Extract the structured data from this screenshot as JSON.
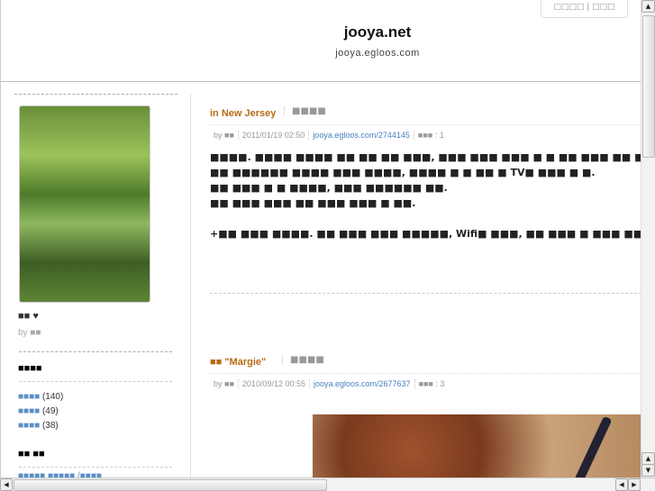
{
  "header": {
    "title": "jooya.net",
    "subtitle": "jooya.egloos.com",
    "top_menu": "□□□□ | □□□"
  },
  "sidebar": {
    "profile_name": "■■",
    "heart": "♥",
    "by_label": "by",
    "by_name": "■■",
    "categories_heading": "■■■■",
    "categories": [
      {
        "label": "■■■■",
        "count": "(140)"
      },
      {
        "label": "■■■■",
        "count": "(49)"
      },
      {
        "label": "■■■■",
        "count": "(38)"
      }
    ],
    "second_heading": "■■ ■■",
    "second_item": "■■■■■ ■■■■■  /■■■■"
  },
  "posts": [
    {
      "title": "in New Jersey",
      "category": "■■■■",
      "by_label": "by",
      "author": "■■",
      "date": "2011/01/19 02:50",
      "link": "jooya.egloos.com/2744145",
      "comments_label": "■■■",
      "comments": ": 1",
      "body": [
        "■■■■. ■■■■ ■■■■ ■■ ■■ ■■ ■■■, ■■■ ■■■ ■■■ ■ ■ ■■ ■■■ ■■ ■■",
        "■■ ■■■■■■ ■■■■ ■■■ ■■■■, ■■■■ ■ ■ ■■ ■ TV■ ■■■ ■ ■.",
        "■■ ■■■ ■ ■ ■■■■, ■■■ ■■■■■■ ■■.",
        "■■ ■■■ ■■■ ■■ ■■■ ■■■ ■ ■■.",
        "",
        "+■■ ■■■ ■■■■. ■■ ■■■ ■■■ ■■■■■, Wifi■ ■■■, ■■ ■■■ ■ ■■■ ■■ ■"
      ]
    },
    {
      "title": "■■ \"Margie\"",
      "category": "■■■■",
      "by_label": "by",
      "author": "■■",
      "date": "2010/09/12 00:55",
      "link": "jooya.egloos.com/2677637",
      "comments_label": "■■■",
      "comments": ": 3"
    }
  ]
}
